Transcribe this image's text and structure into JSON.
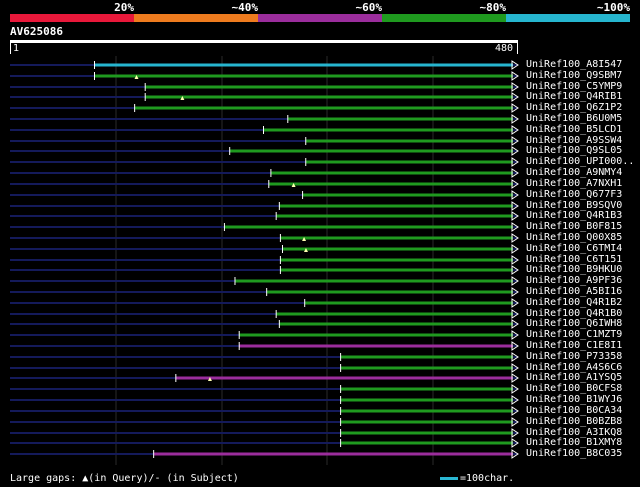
{
  "legend": {
    "segments": [
      {
        "label": "20%",
        "color": "#e8183a"
      },
      {
        "label": "~40%",
        "color": "#ee7b1e"
      },
      {
        "label": "~60%",
        "color": "#9b2d9c"
      },
      {
        "label": "~80%",
        "color": "#1f9a1f"
      },
      {
        "label": "~100%",
        "color": "#26b5cf"
      }
    ]
  },
  "query": {
    "id": "AV625086",
    "start": "1",
    "end": "480",
    "length": 480
  },
  "hits": [
    {
      "name": "UniRef100_A8I547",
      "start": 80,
      "color": "#26b5cf",
      "query_gap": false
    },
    {
      "name": "UniRef100_Q9SBM7",
      "start": 80,
      "color": "#1f9a1f",
      "query_gap": true
    },
    {
      "name": "UniRef100_C5YMP9",
      "start": 128,
      "color": "#1f9a1f",
      "query_gap": false
    },
    {
      "name": "UniRef100_Q4RIB1",
      "start": 128,
      "color": "#1f9a1f",
      "query_gap": true
    },
    {
      "name": "UniRef100_Q6Z1P2",
      "start": 118,
      "color": "#1f9a1f",
      "query_gap": false
    },
    {
      "name": "UniRef100_B6U0M5",
      "start": 263,
      "color": "#1f9a1f",
      "query_gap": false
    },
    {
      "name": "UniRef100_B5LCD1",
      "start": 240,
      "color": "#1f9a1f",
      "query_gap": false
    },
    {
      "name": "UniRef100_A9SSW4",
      "start": 280,
      "color": "#1f9a1f",
      "query_gap": false
    },
    {
      "name": "UniRef100_Q9SL05",
      "start": 208,
      "color": "#1f9a1f",
      "query_gap": false
    },
    {
      "name": "UniRef100_UPI000..",
      "start": 280,
      "color": "#1f9a1f",
      "query_gap": false
    },
    {
      "name": "UniRef100_A9NMY4",
      "start": 247,
      "color": "#1f9a1f",
      "query_gap": false
    },
    {
      "name": "UniRef100_A7NXH1",
      "start": 245,
      "color": "#1f9a1f",
      "query_gap": true
    },
    {
      "name": "UniRef100_Q677F3",
      "start": 277,
      "color": "#1f9a1f",
      "query_gap": false
    },
    {
      "name": "UniRef100_B9SQV0",
      "start": 255,
      "color": "#1f9a1f",
      "query_gap": false
    },
    {
      "name": "UniRef100_Q4R1B3",
      "start": 252,
      "color": "#1f9a1f",
      "query_gap": false
    },
    {
      "name": "UniRef100_B0F815",
      "start": 203,
      "color": "#1f9a1f",
      "query_gap": false
    },
    {
      "name": "UniRef100_Q00X85",
      "start": 256,
      "color": "#1f9a1f",
      "query_gap": true
    },
    {
      "name": "UniRef100_C6TMI4",
      "start": 258,
      "color": "#1f9a1f",
      "query_gap": true
    },
    {
      "name": "UniRef100_C6T151",
      "start": 256,
      "color": "#1f9a1f",
      "query_gap": false
    },
    {
      "name": "UniRef100_B9HKU0",
      "start": 256,
      "color": "#1f9a1f",
      "query_gap": false
    },
    {
      "name": "UniRef100_A9PF36",
      "start": 213,
      "color": "#1f9a1f",
      "query_gap": false
    },
    {
      "name": "UniRef100_A5BI16",
      "start": 243,
      "color": "#1f9a1f",
      "query_gap": false
    },
    {
      "name": "UniRef100_Q4R1B2",
      "start": 279,
      "color": "#1f9a1f",
      "query_gap": false
    },
    {
      "name": "UniRef100_Q4R1B0",
      "start": 252,
      "color": "#1f9a1f",
      "query_gap": false
    },
    {
      "name": "UniRef100_Q6IWH8",
      "start": 255,
      "color": "#1f9a1f",
      "query_gap": false
    },
    {
      "name": "UniRef100_C1MZT9",
      "start": 217,
      "color": "#1f9a1f",
      "query_gap": false
    },
    {
      "name": "UniRef100_C1E8I1",
      "start": 217,
      "color": "#9b2d9c",
      "query_gap": false
    },
    {
      "name": "UniRef100_P73358",
      "start": 313,
      "color": "#1f9a1f",
      "query_gap": false
    },
    {
      "name": "UniRef100_A4S6C6",
      "start": 313,
      "color": "#1f9a1f",
      "query_gap": false
    },
    {
      "name": "UniRef100_A1YSQ5",
      "start": 157,
      "color": "#9b2d9c",
      "query_gap": true
    },
    {
      "name": "UniRef100_B0CFS8",
      "start": 313,
      "color": "#1f9a1f",
      "query_gap": false
    },
    {
      "name": "UniRef100_B1WYJ6",
      "start": 313,
      "color": "#1f9a1f",
      "query_gap": false
    },
    {
      "name": "UniRef100_B0CA34",
      "start": 313,
      "color": "#1f9a1f",
      "query_gap": false
    },
    {
      "name": "UniRef100_B0BZB8",
      "start": 313,
      "color": "#1f9a1f",
      "query_gap": false
    },
    {
      "name": "UniRef100_A3IKQ8",
      "start": 313,
      "color": "#1f9a1f",
      "query_gap": false
    },
    {
      "name": "UniRef100_B1XMY8",
      "start": 313,
      "color": "#1f9a1f",
      "query_gap": false
    },
    {
      "name": "UniRef100_B8C035",
      "start": 136,
      "color": "#9b2d9c",
      "query_gap": false
    }
  ],
  "footer": {
    "prefix": "Large gaps: ",
    "triangle": "▲",
    "text": "(in Query)/- (in Subject)",
    "scale": "=100char."
  }
}
